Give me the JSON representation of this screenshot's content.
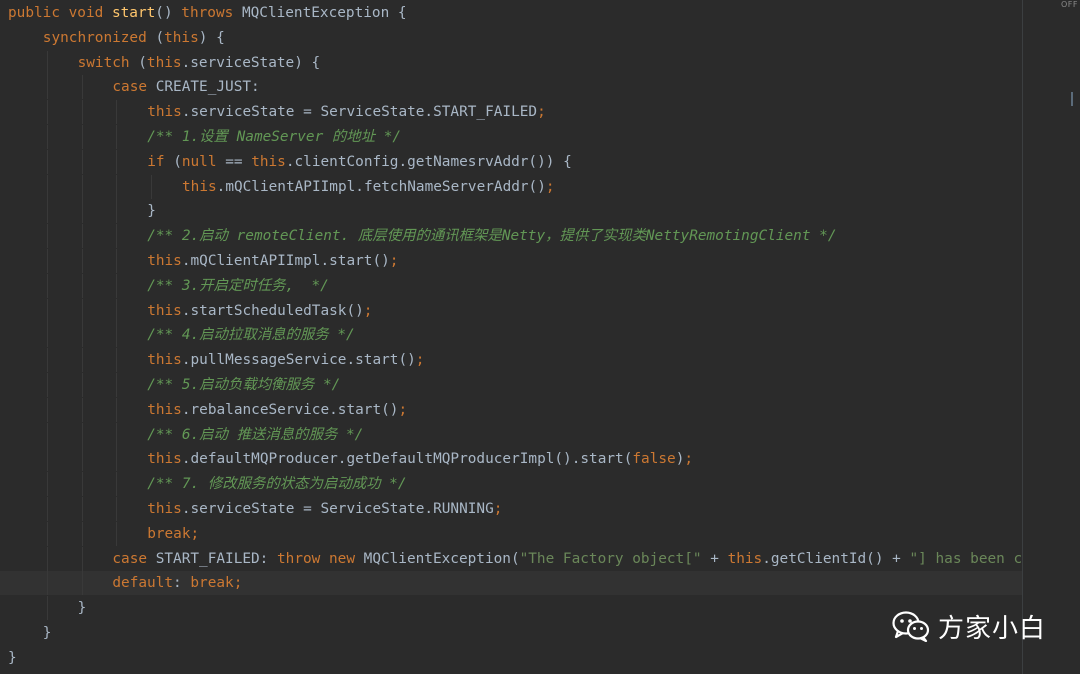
{
  "colors": {
    "background": "#2b2b2b",
    "keyword": "#cc7832",
    "method": "#ffc66d",
    "comment": "#629755",
    "string": "#6a8759",
    "text": "#a9b7c6"
  },
  "gutter": {
    "label": "OFF"
  },
  "watermark": {
    "icon": "wechat-icon",
    "text": "方家小白"
  },
  "code": {
    "lines": [
      {
        "indent": 0,
        "tokens": [
          {
            "t": "kw",
            "v": "public void "
          },
          {
            "t": "fn",
            "v": "start"
          },
          {
            "t": "txt",
            "v": "() "
          },
          {
            "t": "kw",
            "v": "throws "
          },
          {
            "t": "txt",
            "v": "MQClientException {"
          }
        ]
      },
      {
        "indent": 1,
        "tokens": [
          {
            "t": "kw",
            "v": "synchronized "
          },
          {
            "t": "txt",
            "v": "("
          },
          {
            "t": "kw",
            "v": "this"
          },
          {
            "t": "txt",
            "v": ") {"
          }
        ]
      },
      {
        "indent": 2,
        "tokens": [
          {
            "t": "kw",
            "v": "switch "
          },
          {
            "t": "txt",
            "v": "("
          },
          {
            "t": "kw",
            "v": "this"
          },
          {
            "t": "txt",
            "v": ".serviceState) {"
          }
        ]
      },
      {
        "indent": 3,
        "tokens": [
          {
            "t": "kw",
            "v": "case "
          },
          {
            "t": "txt",
            "v": "CREATE_JUST:"
          }
        ]
      },
      {
        "indent": 4,
        "tokens": [
          {
            "t": "kw",
            "v": "this"
          },
          {
            "t": "txt",
            "v": ".serviceState = ServiceState.START_FAILED"
          },
          {
            "t": "punc",
            "v": ";"
          }
        ]
      },
      {
        "indent": 4,
        "tokens": [
          {
            "t": "cmt",
            "v": "/** 1.设置 NameServer 的地址 */"
          }
        ]
      },
      {
        "indent": 4,
        "tokens": [
          {
            "t": "kw",
            "v": "if "
          },
          {
            "t": "txt",
            "v": "("
          },
          {
            "t": "kw",
            "v": "null "
          },
          {
            "t": "txt",
            "v": "== "
          },
          {
            "t": "kw",
            "v": "this"
          },
          {
            "t": "txt",
            "v": ".clientConfig.getNamesrvAddr()) {"
          }
        ]
      },
      {
        "indent": 5,
        "tokens": [
          {
            "t": "kw",
            "v": "this"
          },
          {
            "t": "txt",
            "v": ".mQClientAPIImpl.fetchNameServerAddr()"
          },
          {
            "t": "punc",
            "v": ";"
          }
        ]
      },
      {
        "indent": 4,
        "tokens": [
          {
            "t": "txt",
            "v": "}"
          }
        ]
      },
      {
        "indent": 4,
        "tokens": [
          {
            "t": "cmt",
            "v": "/** 2.启动 remoteClient. 底层使用的通讯框架是Netty，提供了实现类NettyRemotingClient */"
          }
        ]
      },
      {
        "indent": 4,
        "tokens": [
          {
            "t": "kw",
            "v": "this"
          },
          {
            "t": "txt",
            "v": ".mQClientAPIImpl.start()"
          },
          {
            "t": "punc",
            "v": ";"
          }
        ]
      },
      {
        "indent": 4,
        "tokens": [
          {
            "t": "cmt",
            "v": "/** 3.开启定时任务,  */"
          }
        ]
      },
      {
        "indent": 4,
        "tokens": [
          {
            "t": "kw",
            "v": "this"
          },
          {
            "t": "txt",
            "v": ".startScheduledTask()"
          },
          {
            "t": "punc",
            "v": ";"
          }
        ]
      },
      {
        "indent": 4,
        "tokens": [
          {
            "t": "cmt",
            "v": "/** 4.启动拉取消息的服务 */"
          }
        ]
      },
      {
        "indent": 4,
        "tokens": [
          {
            "t": "kw",
            "v": "this"
          },
          {
            "t": "txt",
            "v": ".pullMessageService.start()"
          },
          {
            "t": "punc",
            "v": ";"
          }
        ]
      },
      {
        "indent": 4,
        "tokens": [
          {
            "t": "cmt",
            "v": "/** 5.启动负载均衡服务 */"
          }
        ]
      },
      {
        "indent": 4,
        "tokens": [
          {
            "t": "kw",
            "v": "this"
          },
          {
            "t": "txt",
            "v": ".rebalanceService.start()"
          },
          {
            "t": "punc",
            "v": ";"
          }
        ]
      },
      {
        "indent": 4,
        "tokens": [
          {
            "t": "cmt",
            "v": "/** 6.启动 推送消息的服务 */"
          }
        ]
      },
      {
        "indent": 4,
        "tokens": [
          {
            "t": "kw",
            "v": "this"
          },
          {
            "t": "txt",
            "v": ".defaultMQProducer.getDefaultMQProducerImpl().start("
          },
          {
            "t": "kw",
            "v": "false"
          },
          {
            "t": "txt",
            "v": ")"
          },
          {
            "t": "punc",
            "v": ";"
          }
        ]
      },
      {
        "indent": 4,
        "tokens": [
          {
            "t": "cmt",
            "v": "/** 7. 修改服务的状态为启动成功 */"
          }
        ]
      },
      {
        "indent": 4,
        "tokens": [
          {
            "t": "kw",
            "v": "this"
          },
          {
            "t": "txt",
            "v": ".serviceState = ServiceState.RUNNING"
          },
          {
            "t": "punc",
            "v": ";"
          }
        ]
      },
      {
        "indent": 4,
        "tokens": [
          {
            "t": "kw",
            "v": "break;"
          }
        ]
      },
      {
        "indent": 3,
        "tokens": [
          {
            "t": "kw",
            "v": "case "
          },
          {
            "t": "txt",
            "v": "START_FAILED: "
          },
          {
            "t": "kw",
            "v": "throw new "
          },
          {
            "t": "txt",
            "v": "MQClientException("
          },
          {
            "t": "str",
            "v": "\"The Factory object[\""
          },
          {
            "t": "txt",
            "v": " + "
          },
          {
            "t": "kw",
            "v": "this"
          },
          {
            "t": "txt",
            "v": ".getClientId() + "
          },
          {
            "t": "str",
            "v": "\"] has been created before, and failed.\""
          }
        ]
      },
      {
        "indent": 3,
        "current": true,
        "tokens": [
          {
            "t": "kw",
            "v": "default"
          },
          {
            "t": "txt",
            "v": ": "
          },
          {
            "t": "kw",
            "v": "break;"
          }
        ]
      },
      {
        "indent": 2,
        "tokens": [
          {
            "t": "txt",
            "v": "}"
          }
        ]
      },
      {
        "indent": 1,
        "tokens": [
          {
            "t": "txt",
            "v": "}"
          }
        ]
      },
      {
        "indent": 0,
        "tokens": [
          {
            "t": "txt",
            "v": "}"
          }
        ]
      }
    ]
  }
}
